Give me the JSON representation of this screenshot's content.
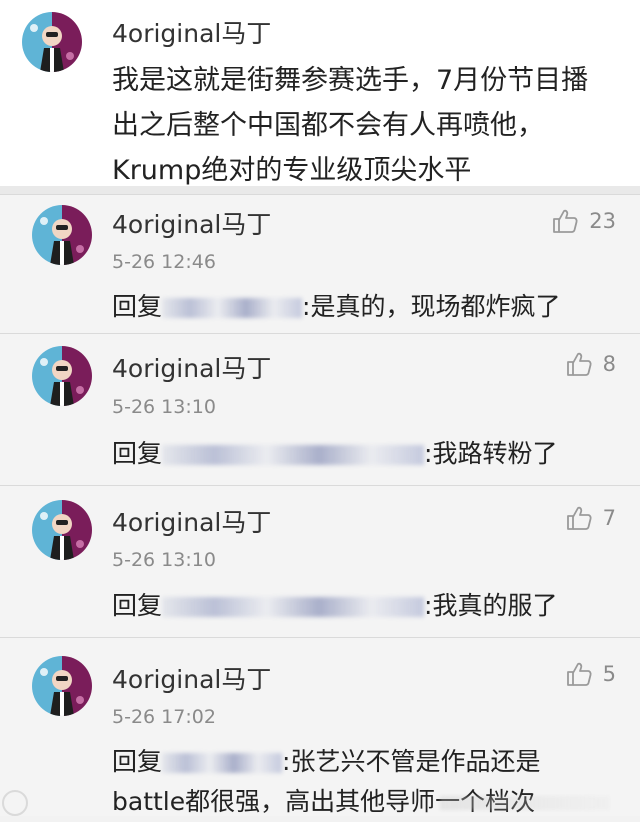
{
  "post": {
    "username": "4original马丁",
    "text": "我是这就是街舞参赛选手，7月份节目播出之后整个中国都不会有人再喷他，Krump绝对的专业级顶尖水平"
  },
  "comments": [
    {
      "username": "4original马丁",
      "time": "5-26 12:46",
      "reply_prefix": "回复",
      "reply_text": ":是真的，现场都炸疯了",
      "likes": "23"
    },
    {
      "username": "4original马丁",
      "time": "5-26 13:10",
      "reply_prefix": "回复",
      "reply_text": ":我路转粉了",
      "likes": "8"
    },
    {
      "username": "4original马丁",
      "time": "5-26 13:10",
      "reply_prefix": "回复",
      "reply_text": ":我真的服了",
      "likes": "7"
    },
    {
      "username": "4original马丁",
      "time": "5-26 17:02",
      "reply_prefix": "回复",
      "reply_text": ":张艺兴不管是作品还是battle都很强，高出其他导师一个档次",
      "likes": "5"
    }
  ]
}
